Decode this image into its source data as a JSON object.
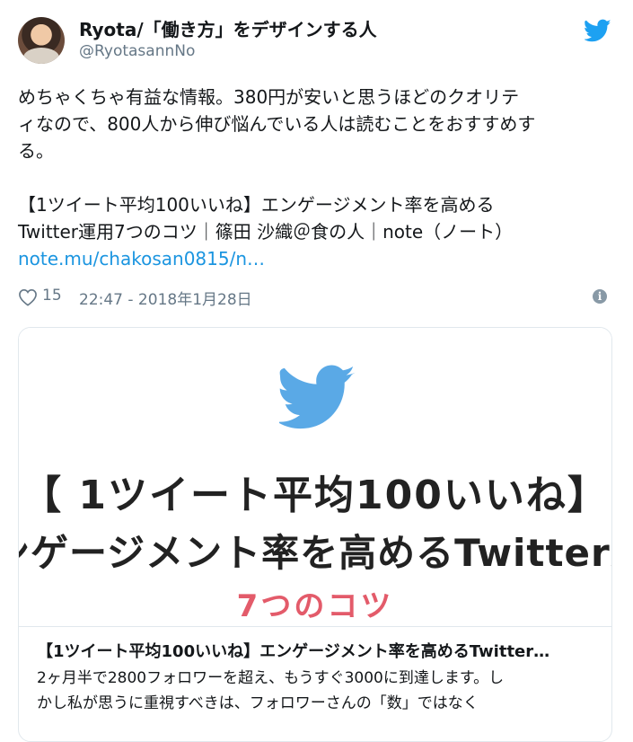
{
  "author": {
    "display_name": "Ryota/「働き方」をデザインする人",
    "handle": "@RyotasannNo"
  },
  "icons": {
    "brand": "twitter-bird-icon",
    "like": "heart-icon",
    "info": "info-icon"
  },
  "colors": {
    "twitter_blue": "#1da1f2",
    "link": "#1b95e0",
    "secondary_text": "#657786",
    "card_accent": "#e35b6a"
  },
  "tweet": {
    "text_line1": "めちゃくちゃ有益な情報。380円が安いと思うほどのクオリテ",
    "text_line2": "ィなので、800人から伸び悩んでいる人は読むことをおすすめす",
    "text_line3": "る。",
    "quote_line1": "【1ツイート平均100いいね】エンゲージメント率を高める",
    "quote_line2": "Twitter運用7つのコツ｜篠田 沙織＠食の人｜note（ノート）",
    "link_text": "note.mu/chakosan0815/n…"
  },
  "meta": {
    "like_count": "15",
    "timestamp": "22:47 - 2018年1月28日",
    "info_glyph": "i"
  },
  "card": {
    "image_line1": "【 1ツイート平均100いいね】",
    "image_line2": "ンゲージメント率を高めるTwitter運",
    "image_line3": "7つのコツ",
    "title": "【1ツイート平均100いいね】エンゲージメント率を高めるTwitter…",
    "desc_line1": "2ヶ月半で2800フォロワーを超え、もうすぐ3000に到達します。し",
    "desc_line2": "かし私が思うに重視すべきは、フォロワーさんの「数」ではなく"
  }
}
